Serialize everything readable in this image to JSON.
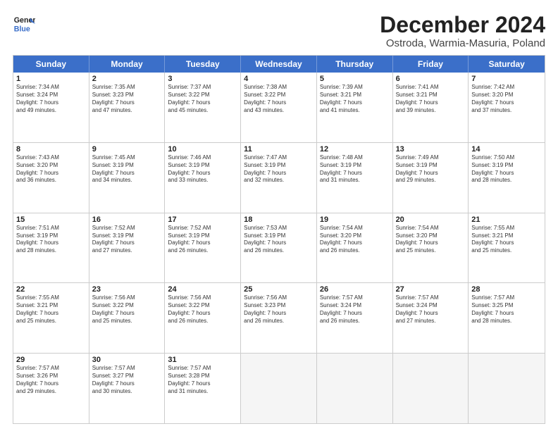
{
  "logo": {
    "line1": "General",
    "line2": "Blue"
  },
  "title": "December 2024",
  "subtitle": "Ostroda, Warmia-Masuria, Poland",
  "days": [
    "Sunday",
    "Monday",
    "Tuesday",
    "Wednesday",
    "Thursday",
    "Friday",
    "Saturday"
  ],
  "weeks": [
    [
      {
        "day": "1",
        "lines": [
          "Sunrise: 7:34 AM",
          "Sunset: 3:24 PM",
          "Daylight: 7 hours",
          "and 49 minutes."
        ]
      },
      {
        "day": "2",
        "lines": [
          "Sunrise: 7:35 AM",
          "Sunset: 3:23 PM",
          "Daylight: 7 hours",
          "and 47 minutes."
        ]
      },
      {
        "day": "3",
        "lines": [
          "Sunrise: 7:37 AM",
          "Sunset: 3:22 PM",
          "Daylight: 7 hours",
          "and 45 minutes."
        ]
      },
      {
        "day": "4",
        "lines": [
          "Sunrise: 7:38 AM",
          "Sunset: 3:22 PM",
          "Daylight: 7 hours",
          "and 43 minutes."
        ]
      },
      {
        "day": "5",
        "lines": [
          "Sunrise: 7:39 AM",
          "Sunset: 3:21 PM",
          "Daylight: 7 hours",
          "and 41 minutes."
        ]
      },
      {
        "day": "6",
        "lines": [
          "Sunrise: 7:41 AM",
          "Sunset: 3:21 PM",
          "Daylight: 7 hours",
          "and 39 minutes."
        ]
      },
      {
        "day": "7",
        "lines": [
          "Sunrise: 7:42 AM",
          "Sunset: 3:20 PM",
          "Daylight: 7 hours",
          "and 37 minutes."
        ]
      }
    ],
    [
      {
        "day": "8",
        "lines": [
          "Sunrise: 7:43 AM",
          "Sunset: 3:20 PM",
          "Daylight: 7 hours",
          "and 36 minutes."
        ]
      },
      {
        "day": "9",
        "lines": [
          "Sunrise: 7:45 AM",
          "Sunset: 3:19 PM",
          "Daylight: 7 hours",
          "and 34 minutes."
        ]
      },
      {
        "day": "10",
        "lines": [
          "Sunrise: 7:46 AM",
          "Sunset: 3:19 PM",
          "Daylight: 7 hours",
          "and 33 minutes."
        ]
      },
      {
        "day": "11",
        "lines": [
          "Sunrise: 7:47 AM",
          "Sunset: 3:19 PM",
          "Daylight: 7 hours",
          "and 32 minutes."
        ]
      },
      {
        "day": "12",
        "lines": [
          "Sunrise: 7:48 AM",
          "Sunset: 3:19 PM",
          "Daylight: 7 hours",
          "and 31 minutes."
        ]
      },
      {
        "day": "13",
        "lines": [
          "Sunrise: 7:49 AM",
          "Sunset: 3:19 PM",
          "Daylight: 7 hours",
          "and 29 minutes."
        ]
      },
      {
        "day": "14",
        "lines": [
          "Sunrise: 7:50 AM",
          "Sunset: 3:19 PM",
          "Daylight: 7 hours",
          "and 28 minutes."
        ]
      }
    ],
    [
      {
        "day": "15",
        "lines": [
          "Sunrise: 7:51 AM",
          "Sunset: 3:19 PM",
          "Daylight: 7 hours",
          "and 28 minutes."
        ]
      },
      {
        "day": "16",
        "lines": [
          "Sunrise: 7:52 AM",
          "Sunset: 3:19 PM",
          "Daylight: 7 hours",
          "and 27 minutes."
        ]
      },
      {
        "day": "17",
        "lines": [
          "Sunrise: 7:52 AM",
          "Sunset: 3:19 PM",
          "Daylight: 7 hours",
          "and 26 minutes."
        ]
      },
      {
        "day": "18",
        "lines": [
          "Sunrise: 7:53 AM",
          "Sunset: 3:19 PM",
          "Daylight: 7 hours",
          "and 26 minutes."
        ]
      },
      {
        "day": "19",
        "lines": [
          "Sunrise: 7:54 AM",
          "Sunset: 3:20 PM",
          "Daylight: 7 hours",
          "and 26 minutes."
        ]
      },
      {
        "day": "20",
        "lines": [
          "Sunrise: 7:54 AM",
          "Sunset: 3:20 PM",
          "Daylight: 7 hours",
          "and 25 minutes."
        ]
      },
      {
        "day": "21",
        "lines": [
          "Sunrise: 7:55 AM",
          "Sunset: 3:21 PM",
          "Daylight: 7 hours",
          "and 25 minutes."
        ]
      }
    ],
    [
      {
        "day": "22",
        "lines": [
          "Sunrise: 7:55 AM",
          "Sunset: 3:21 PM",
          "Daylight: 7 hours",
          "and 25 minutes."
        ]
      },
      {
        "day": "23",
        "lines": [
          "Sunrise: 7:56 AM",
          "Sunset: 3:22 PM",
          "Daylight: 7 hours",
          "and 25 minutes."
        ]
      },
      {
        "day": "24",
        "lines": [
          "Sunrise: 7:56 AM",
          "Sunset: 3:22 PM",
          "Daylight: 7 hours",
          "and 26 minutes."
        ]
      },
      {
        "day": "25",
        "lines": [
          "Sunrise: 7:56 AM",
          "Sunset: 3:23 PM",
          "Daylight: 7 hours",
          "and 26 minutes."
        ]
      },
      {
        "day": "26",
        "lines": [
          "Sunrise: 7:57 AM",
          "Sunset: 3:24 PM",
          "Daylight: 7 hours",
          "and 26 minutes."
        ]
      },
      {
        "day": "27",
        "lines": [
          "Sunrise: 7:57 AM",
          "Sunset: 3:24 PM",
          "Daylight: 7 hours",
          "and 27 minutes."
        ]
      },
      {
        "day": "28",
        "lines": [
          "Sunrise: 7:57 AM",
          "Sunset: 3:25 PM",
          "Daylight: 7 hours",
          "and 28 minutes."
        ]
      }
    ],
    [
      {
        "day": "29",
        "lines": [
          "Sunrise: 7:57 AM",
          "Sunset: 3:26 PM",
          "Daylight: 7 hours",
          "and 29 minutes."
        ]
      },
      {
        "day": "30",
        "lines": [
          "Sunrise: 7:57 AM",
          "Sunset: 3:27 PM",
          "Daylight: 7 hours",
          "and 30 minutes."
        ]
      },
      {
        "day": "31",
        "lines": [
          "Sunrise: 7:57 AM",
          "Sunset: 3:28 PM",
          "Daylight: 7 hours",
          "and 31 minutes."
        ]
      },
      {
        "day": "",
        "lines": []
      },
      {
        "day": "",
        "lines": []
      },
      {
        "day": "",
        "lines": []
      },
      {
        "day": "",
        "lines": []
      }
    ]
  ]
}
